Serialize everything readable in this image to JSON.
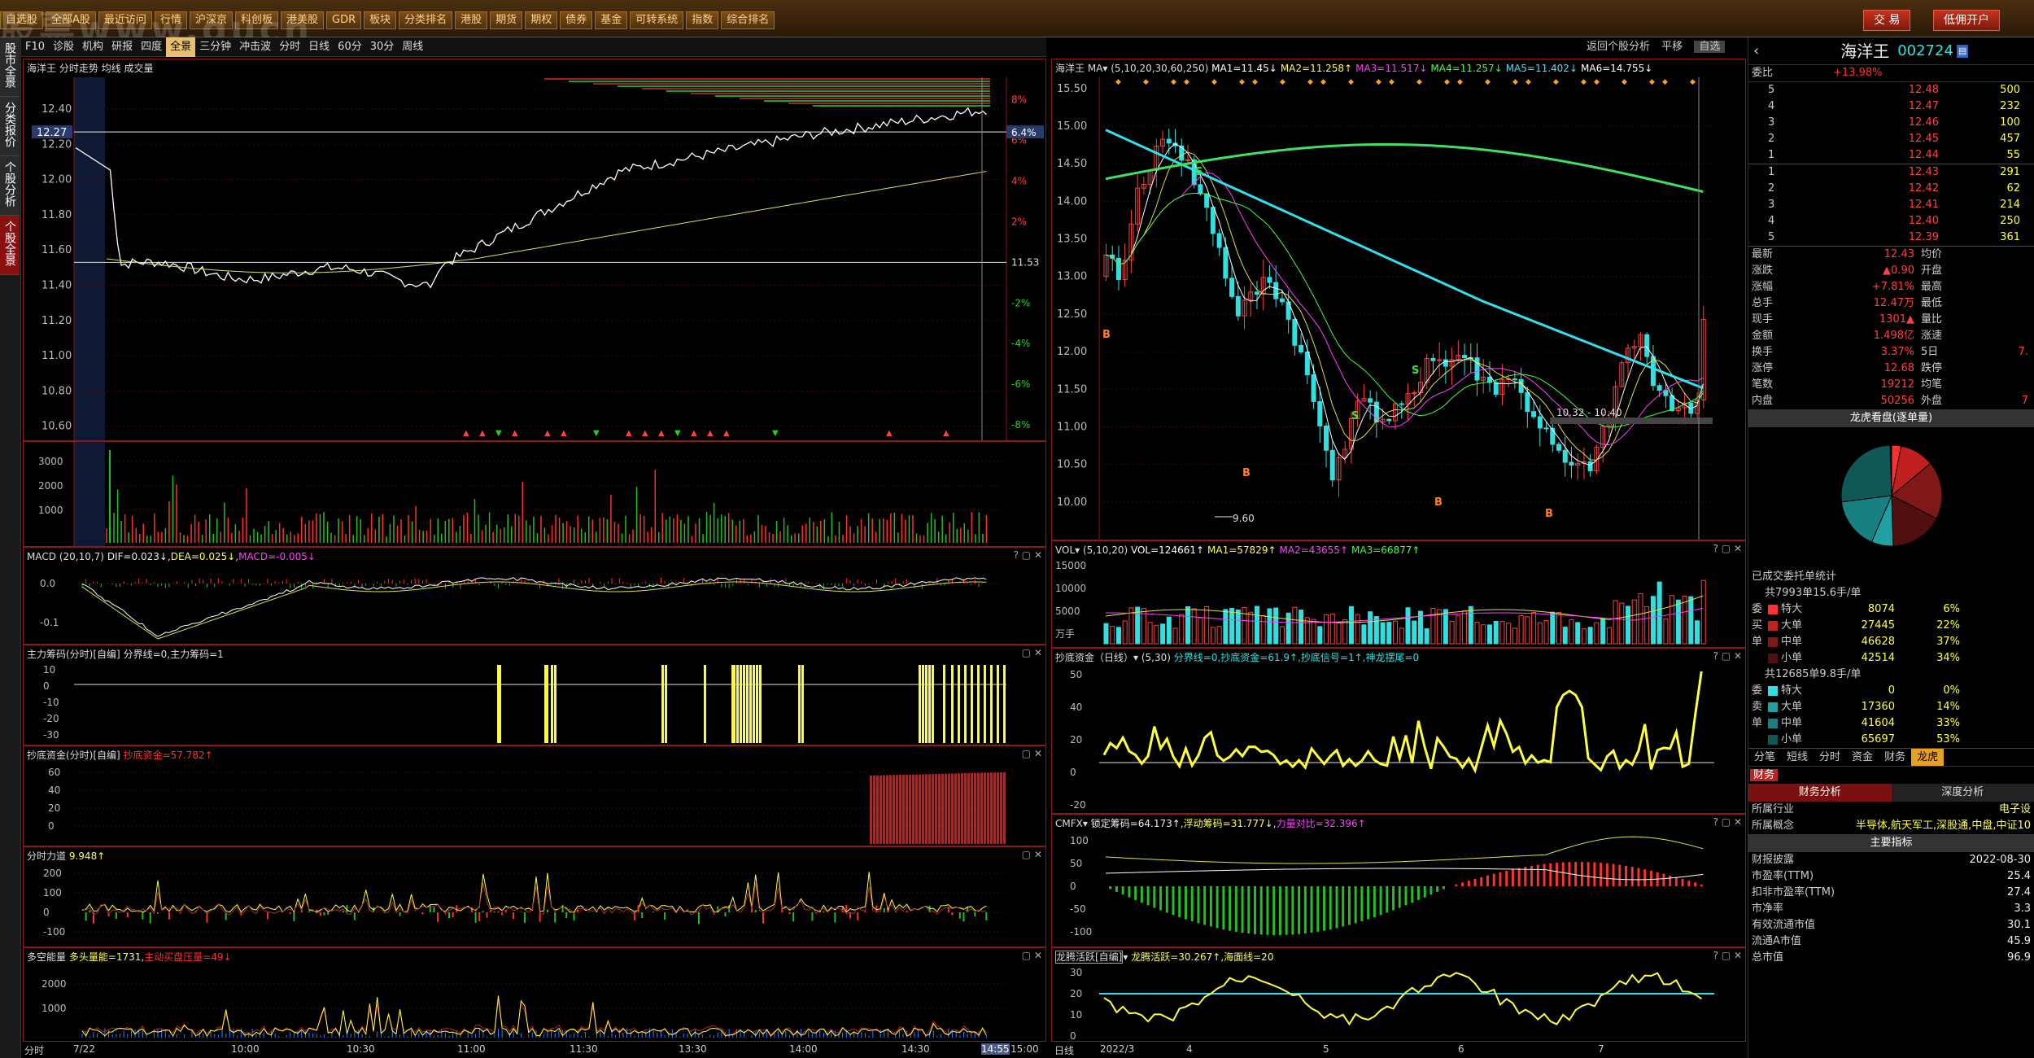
{
  "topbar": {
    "watermark": "股票www.gucn",
    "menus": [
      "自选股",
      "全部A股",
      "最近访问",
      "行情",
      "沪深京",
      "科创板",
      "港美股",
      "GDR",
      "板块",
      "分类排名",
      "港股",
      "期货",
      "期权",
      "债券",
      "基金",
      "可转系统",
      "指数",
      "综合排名"
    ],
    "trade_btn": "交 易",
    "open_btn": "低佣开户"
  },
  "left_tabs": [
    "股市全景",
    "分类报价",
    "个股分析",
    "个股全景"
  ],
  "subtabs": [
    "F10",
    "诊股",
    "机构",
    "研报",
    "四度",
    "全景",
    "三分钟",
    "冲击波",
    "分时",
    "日线",
    "60分",
    "30分",
    "周线"
  ],
  "right_top": {
    "back": "返回个股分析",
    "flat": "平移",
    "watch": "自选"
  },
  "intraday": {
    "title": "海洋王 分时走势 均线 成交量",
    "yticks": [
      "12.40",
      "12.20",
      "12.00",
      "11.80",
      "11.60",
      "11.40",
      "11.20",
      "11.00",
      "10.80",
      "10.60"
    ],
    "pct": [
      "8%",
      "6%",
      "4%",
      "2%",
      "-2%",
      "-4%",
      "-6%",
      "-8%"
    ],
    "cur": "12.27",
    "curpct": "6.4%",
    "base": "11.53",
    "vol_ticks": [
      "3000",
      "2000",
      "1000"
    ],
    "xaxis": [
      "分时",
      "7/22",
      "10:00",
      "10:30",
      "11:00",
      "11:30",
      "13:30",
      "14:00",
      "14:30",
      "14:55",
      "15:00"
    ]
  },
  "macd": {
    "title": "MACD",
    "params": "(20,10,7)",
    "dif": "DIF=0.023↓",
    "dea": "DEA=0.025↓",
    "macd": "MACD=-0.005↓",
    "ticks": [
      "0.0",
      "-0.1"
    ]
  },
  "zl": {
    "title": "主力筹码(分时)[自编]",
    "txt": "分界线=0,主力筹码=1",
    "ticks": [
      "10",
      "0",
      "-10",
      "-20",
      "-30"
    ]
  },
  "cd": {
    "title": "抄底资金(分时)[自编]",
    "txt": "抄底资金=57.782↑",
    "ticks": [
      "60",
      "40",
      "20",
      "0"
    ]
  },
  "fsld": {
    "title": "分时力道",
    "txt": "9.948↑",
    "ticks": [
      "200",
      "100",
      "0",
      "-100"
    ]
  },
  "dk": {
    "title": "多空能量",
    "t1": "多头量能=1731",
    "t2": "主动买盘压量=49↓",
    "ticks": [
      "2000",
      "1000"
    ]
  },
  "kline": {
    "title": "海洋王",
    "ma": "MA",
    "params": "(5,10,20,30,60,250)",
    "mas": [
      "MA1=11.45↓",
      "MA2=11.258↑",
      "MA3=11.517↓",
      "MA4=11.257↓",
      "MA5=11.402↓",
      "MA6=14.755↓"
    ],
    "yticks": [
      "15.50",
      "15.00",
      "14.50",
      "14.00",
      "13.50",
      "13.00",
      "12.50",
      "12.00",
      "11.50",
      "11.00",
      "10.50",
      "10.00"
    ],
    "low": "9.60",
    "range": "10.32 - 10.40",
    "xaxis": [
      "日线",
      "2022/3",
      "4",
      "5",
      "6",
      "7"
    ]
  },
  "vol": {
    "title": "VOL",
    "params": "(5,10,20)",
    "txt": [
      "VOL=124661↑",
      "MA1=57829↑",
      "MA2=43655↑",
      "MA3=66877↑"
    ],
    "ticks": [
      "15000",
      "10000",
      "5000",
      "万手"
    ]
  },
  "cdd": {
    "title": "抄底资金（日线）",
    "params": "(5,30)",
    "txt": "分界线=0,抄底资金=61.9↑,抄底信号=1↑,神龙摆尾=0",
    "ticks": [
      "50",
      "40",
      "20",
      "0",
      "-20"
    ]
  },
  "cmfx": {
    "title": "CMFX",
    "txt": [
      "锁定筹码=64.173↑",
      "浮动筹码=31.777↓",
      "力量对比=32.396↑"
    ],
    "ticks": [
      "100",
      "50",
      "0",
      "-50",
      "-100"
    ]
  },
  "lthy": {
    "title": "龙腾活跃[自编]",
    "txt": "龙腾活跃=30.267↑,海面线=20",
    "ticks": [
      "30",
      "20",
      "10",
      "0"
    ]
  },
  "stock": {
    "name": "海洋王",
    "code": "002724",
    "webi": "委比",
    "webi_v": "+13.98%",
    "sell": [
      [
        "5",
        "12.48",
        "500"
      ],
      [
        "4",
        "12.47",
        "232"
      ],
      [
        "3",
        "12.46",
        "100"
      ],
      [
        "2",
        "12.45",
        "457"
      ],
      [
        "1",
        "12.44",
        "55"
      ]
    ],
    "buy": [
      [
        "1",
        "12.43",
        "291"
      ],
      [
        "2",
        "12.42",
        "62"
      ],
      [
        "3",
        "12.41",
        "214"
      ],
      [
        "4",
        "12.40",
        "250"
      ],
      [
        "5",
        "12.39",
        "361"
      ]
    ],
    "info": [
      [
        "最新",
        "12.43",
        "均价",
        ""
      ],
      [
        "涨跌",
        "▲0.90",
        "开盘",
        ""
      ],
      [
        "涨幅",
        "+7.81%",
        "最高",
        ""
      ],
      [
        "总手",
        "12.47万",
        "最低",
        ""
      ],
      [
        "现手",
        "1301▲",
        "量比",
        ""
      ],
      [
        "金额",
        "1.498亿",
        "涨速",
        ""
      ],
      [
        "换手",
        "3.37%",
        "5日",
        "7."
      ],
      [
        "涨停",
        "12.68",
        "跌停",
        ""
      ],
      [
        "笔数",
        "19212",
        "均笔",
        ""
      ],
      [
        "内盘",
        "50256",
        "外盘",
        "7"
      ]
    ],
    "lhk": "龙虎看盘(逐单量)",
    "yct": "已成交委托单统计",
    "g1": "共7993单15.6手/单",
    "g1rows": [
      [
        "委",
        "特大",
        "8074",
        "6%"
      ],
      [
        "买",
        "大单",
        "27445",
        "22%"
      ],
      [
        "单",
        "中单",
        "46628",
        "37%"
      ],
      [
        "",
        "小单",
        "42514",
        "34%"
      ]
    ],
    "g2": "共12685单9.8手/单",
    "g2rows": [
      [
        "委",
        "特大",
        "0",
        "0%"
      ],
      [
        "卖",
        "大单",
        "17360",
        "14%"
      ],
      [
        "单",
        "中单",
        "41604",
        "33%"
      ],
      [
        "",
        "小单",
        "65697",
        "53%"
      ]
    ],
    "btabs": [
      "分笔",
      "短线",
      "分时",
      "资金",
      "财务",
      "龙虎"
    ],
    "cw": "财务",
    "cwtabs": [
      "财务分析",
      "深度分析"
    ],
    "sector": [
      [
        "所属行业",
        "电子设"
      ],
      [
        "所属概念",
        "半导体,航天军工,深股通,中盘,中证10"
      ]
    ],
    "zyzb": "主要指标",
    "fin": [
      [
        "财报披露",
        "2022-08-30"
      ],
      [
        "市盈率(TTM)",
        "25.4"
      ],
      [
        "扣非市盈率(TTM)",
        "27.4"
      ],
      [
        "市净率",
        "3.3"
      ],
      [
        "有效流通市值",
        "30.1"
      ],
      [
        "流通A市值",
        "45.9"
      ],
      [
        "总市值",
        "96.9"
      ]
    ]
  }
}
